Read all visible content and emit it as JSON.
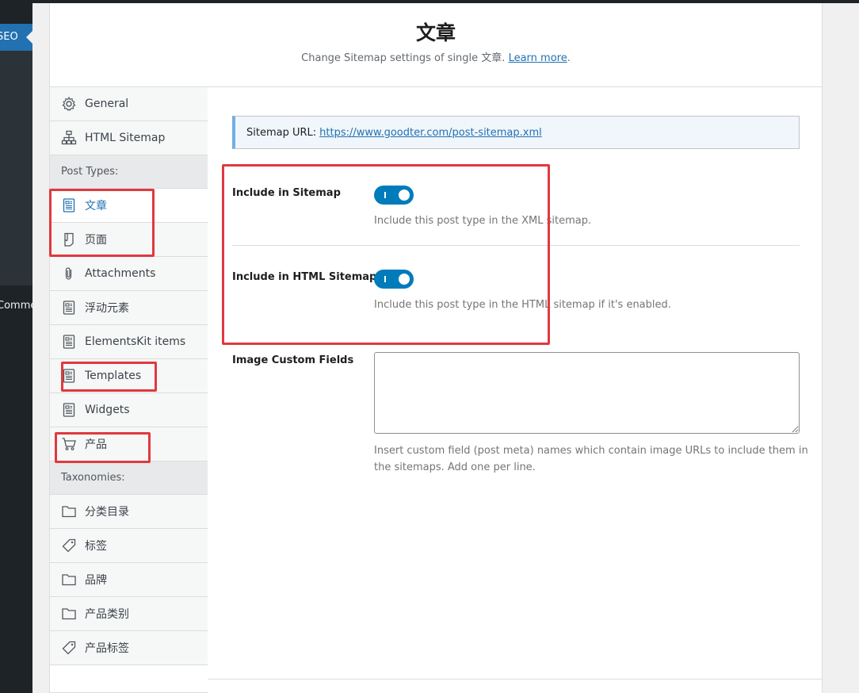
{
  "wp_sidebar": {
    "active_label": "SEO",
    "menu_label": "Commerce"
  },
  "header": {
    "title": "文章",
    "subtitle": "Change Sitemap settings of single 文章.",
    "learn_more": "Learn more",
    "period": "."
  },
  "nav": {
    "items_top": [
      {
        "label": "General",
        "icon": "gear-icon"
      },
      {
        "label": "HTML Sitemap",
        "icon": "sitemap-icon"
      }
    ],
    "section_post_types": "Post Types:",
    "post_types": [
      {
        "label": "文章",
        "icon": "document-icon",
        "active": true
      },
      {
        "label": "页面",
        "icon": "page-icon"
      },
      {
        "label": "Attachments",
        "icon": "paperclip-icon"
      },
      {
        "label": "浮动元素",
        "icon": "document-icon"
      },
      {
        "label": "ElementsKit items",
        "icon": "document-icon"
      },
      {
        "label": "Templates",
        "icon": "document-icon"
      },
      {
        "label": "Widgets",
        "icon": "document-icon"
      },
      {
        "label": "产品",
        "icon": "cart-icon"
      }
    ],
    "section_taxonomies": "Taxonomies:",
    "taxonomies": [
      {
        "label": "分类目录",
        "icon": "folder-icon"
      },
      {
        "label": "标签",
        "icon": "tag-icon"
      },
      {
        "label": "品牌",
        "icon": "folder-icon"
      },
      {
        "label": "产品类别",
        "icon": "folder-icon"
      },
      {
        "label": "产品标签",
        "icon": "tag-icon"
      }
    ]
  },
  "content": {
    "sitemap_url_label": "Sitemap URL:",
    "sitemap_url": "https://www.goodter.com/post-sitemap.xml",
    "include_sitemap": {
      "label": "Include in Sitemap",
      "enabled": true,
      "description": "Include this post type in the XML sitemap."
    },
    "include_html_sitemap": {
      "label": "Include in HTML Sitemap",
      "enabled": true,
      "description": "Include this post type in the HTML sitemap if it's enabled."
    },
    "image_custom_fields": {
      "label": "Image Custom Fields",
      "value": "",
      "description_line1": "Insert custom field (post meta) names which contain image URLs to include them in",
      "description_line2": "the sitemaps. Add one per line."
    }
  },
  "colors": {
    "accent": "#2271b1",
    "toggle_on": "#007cba",
    "highlight": "#e0393e",
    "admin_dark": "#1d2327"
  }
}
